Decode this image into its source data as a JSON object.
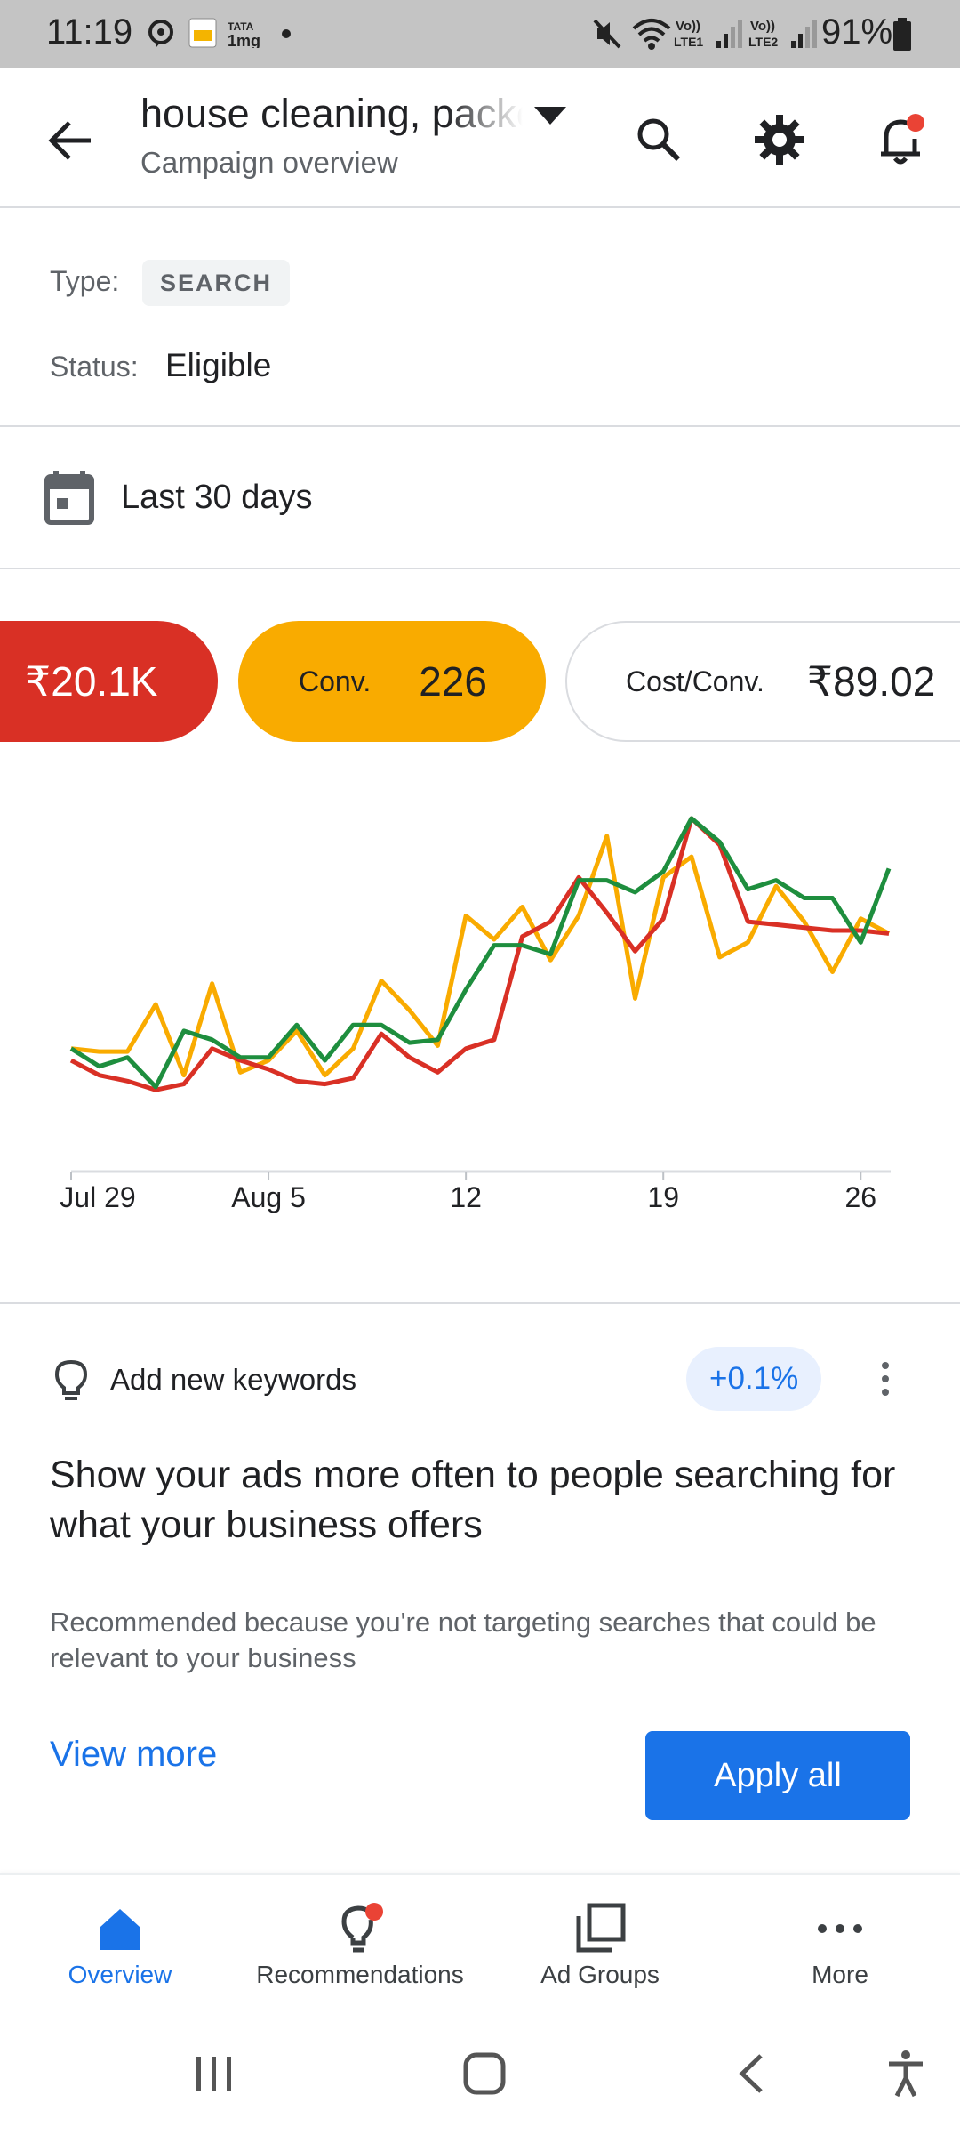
{
  "status_bar": {
    "time": "11:19",
    "battery_percent": "91%",
    "icons": [
      "message-icon",
      "app-notification-icon",
      "tata-1mg-icon",
      "dot-icon",
      "mute-icon",
      "wifi-icon",
      "volte-lte1-signal-icon",
      "volte-lte2-signal-icon",
      "battery-icon"
    ]
  },
  "header": {
    "campaign_name": "house cleaning, packers and movers",
    "subtitle": "Campaign overview",
    "actions": [
      "search-icon",
      "settings-icon",
      "notifications-icon"
    ],
    "notification_dot_color": "#ea4335"
  },
  "campaign_info": {
    "type_label": "Type:",
    "type_value": "SEARCH",
    "status_label": "Status:",
    "status_value": "Eligible"
  },
  "date_range": {
    "label": "Last 30 days"
  },
  "metrics": {
    "cost": {
      "value": "₹20.1K",
      "color": "#d93025"
    },
    "conversions": {
      "label": "Conv.",
      "value": "226",
      "color": "#f9ab00"
    },
    "cost_per_conv": {
      "label": "Cost/Conv.",
      "value": "₹89.02"
    }
  },
  "chart_data": {
    "type": "line",
    "x_labels": [
      "Jul 29",
      "Aug 5",
      "12",
      "19",
      "26"
    ],
    "x_label_index": [
      1,
      8,
      15,
      22,
      29
    ],
    "y_axis_visible": false,
    "grid": false,
    "series": [
      {
        "color": "#d93025",
        "values": [
          0.25,
          0.2,
          0.18,
          0.15,
          0.17,
          0.29,
          0.25,
          0.22,
          0.18,
          0.17,
          0.19,
          0.34,
          0.26,
          0.21,
          0.29,
          0.32,
          0.67,
          0.72,
          0.87,
          0.75,
          0.62,
          0.73,
          1.07,
          0.98,
          0.72,
          0.71,
          0.7,
          0.69,
          0.69,
          0.68
        ]
      },
      {
        "color": "#f9ab00",
        "values": [
          0.29,
          0.28,
          0.28,
          0.44,
          0.2,
          0.51,
          0.21,
          0.25,
          0.35,
          0.2,
          0.29,
          0.52,
          0.42,
          0.3,
          0.74,
          0.66,
          0.77,
          0.59,
          0.74,
          1.01,
          0.46,
          0.87,
          0.94,
          0.6,
          0.65,
          0.84,
          0.72,
          0.55,
          0.73,
          0.68
        ]
      },
      {
        "color": "#1e8e3e",
        "values": [
          0.29,
          0.23,
          0.26,
          0.16,
          0.35,
          0.32,
          0.26,
          0.26,
          0.37,
          0.25,
          0.37,
          0.37,
          0.31,
          0.32,
          0.49,
          0.64,
          0.64,
          0.61,
          0.86,
          0.86,
          0.82,
          0.89,
          1.07,
          0.99,
          0.83,
          0.86,
          0.8,
          0.8,
          0.65,
          0.9
        ]
      }
    ]
  },
  "recommendation": {
    "title": "Add new keywords",
    "uplift": "+0.1%",
    "headline": "Show your ads more often to people searching for what your business offers",
    "body": "Recommended because you're not targeting searches that could be relevant to your business",
    "view_more": "View more",
    "apply_all": "Apply all"
  },
  "bottom_nav": {
    "items": [
      {
        "label": "Overview",
        "icon": "home-icon",
        "active": true
      },
      {
        "label": "Recommendations",
        "icon": "lightbulb-icon",
        "active": false
      },
      {
        "label": "Ad Groups",
        "icon": "ad-groups-icon",
        "active": false
      },
      {
        "label": "More",
        "icon": "more-icon",
        "active": false
      }
    ]
  },
  "system_nav": [
    "recents-icon",
    "home-button-icon",
    "back-icon",
    "accessibility-icon"
  ]
}
